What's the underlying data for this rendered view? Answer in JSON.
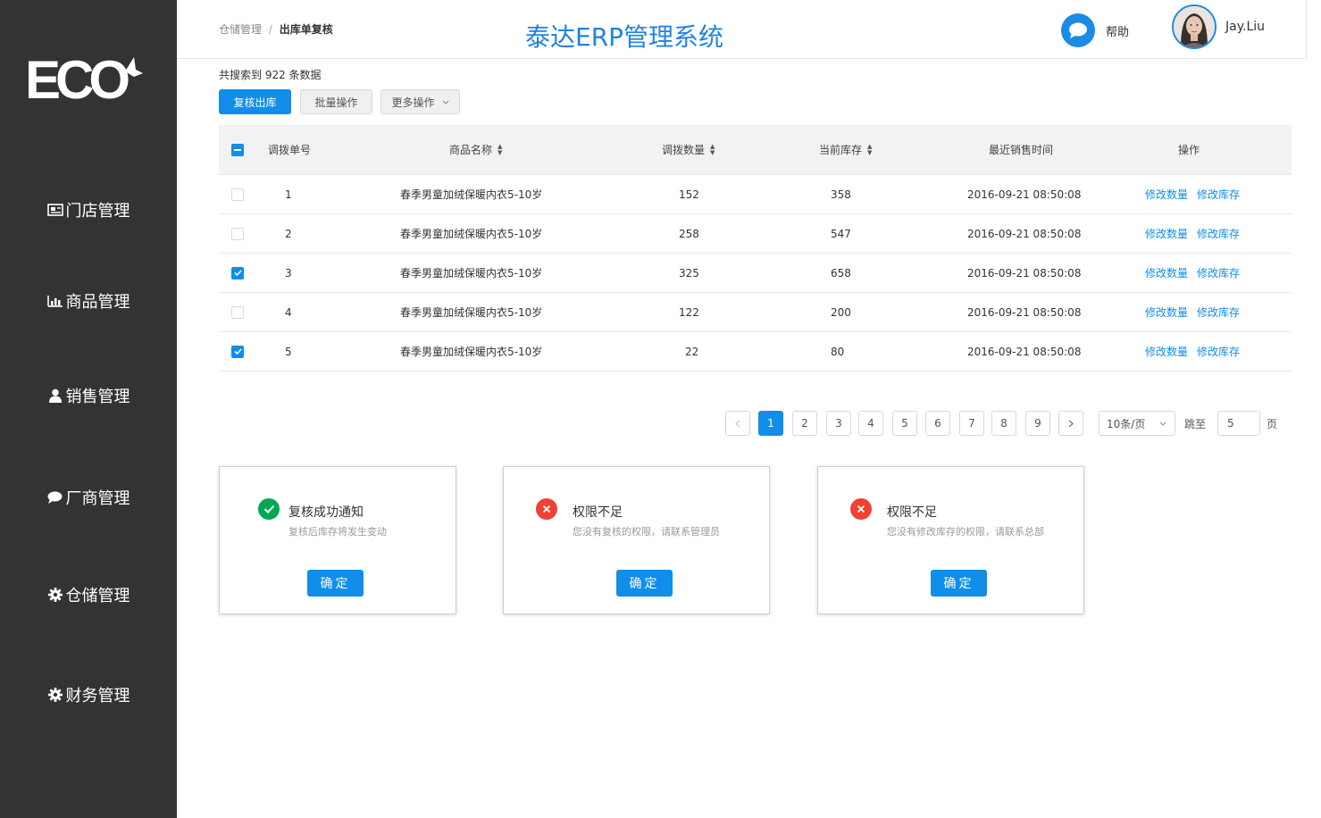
{
  "sidebar": {
    "logo_text": "ECO",
    "items": [
      {
        "label": "门店管理",
        "icon": "newspaper-icon"
      },
      {
        "label": "商品管理",
        "icon": "bar-chart-icon"
      },
      {
        "label": "销售管理",
        "icon": "user-icon"
      },
      {
        "label": "厂商管理",
        "icon": "comment-icon"
      },
      {
        "label": "仓储管理",
        "icon": "gear-icon"
      },
      {
        "label": "财务管理",
        "icon": "gear-icon"
      }
    ]
  },
  "header": {
    "breadcrumb_parent": "仓储管理",
    "breadcrumb_sep": "/",
    "breadcrumb_current": "出库单复核",
    "title": "泰达ERP管理系统",
    "help_label": "帮助",
    "user_name": "Jay.Liu"
  },
  "toolbar": {
    "count_text": "共搜索到 922 条数据",
    "review_label": "复核出库",
    "batch_label": "批量操作",
    "more_label": "更多操作"
  },
  "table": {
    "headers": {
      "id": "调拨单号",
      "name": "商品名称",
      "qty": "调拨数量",
      "stock": "当前库存",
      "time": "最近销售时间",
      "action": "操作"
    },
    "action_edit_qty": "修改数量",
    "action_edit_stock": "修改库存",
    "rows": [
      {
        "id": "1",
        "name": "春季男童加绒保暖内衣5-10岁",
        "qty": "152",
        "stock": "358",
        "time": "2016-09-21  08:50:08",
        "checked": false
      },
      {
        "id": "2",
        "name": "春季男童加绒保暖内衣5-10岁",
        "qty": "258",
        "stock": "547",
        "time": "2016-09-21  08:50:08",
        "checked": false
      },
      {
        "id": "3",
        "name": "春季男童加绒保暖内衣5-10岁",
        "qty": "325",
        "stock": "658",
        "time": "2016-09-21  08:50:08",
        "checked": true
      },
      {
        "id": "4",
        "name": "春季男童加绒保暖内衣5-10岁",
        "qty": "122",
        "stock": "200",
        "time": "2016-09-21  08:50:08",
        "checked": false
      },
      {
        "id": "5",
        "name": "春季男童加绒保暖内衣5-10岁",
        "qty": "22",
        "stock": "80",
        "time": "2016-09-21  08:50:08",
        "checked": true
      }
    ]
  },
  "pagination": {
    "pages": [
      "1",
      "2",
      "3",
      "4",
      "5",
      "6",
      "7",
      "8",
      "9"
    ],
    "current": "1",
    "page_size": "10条/页",
    "jump_label": "跳至",
    "jump_value": "5",
    "page_unit": "页"
  },
  "dialogs": [
    {
      "type": "success",
      "title": "复核成功通知",
      "message": "复核后库存将发生变动",
      "button": "确定"
    },
    {
      "type": "error",
      "title": "权限不足",
      "message": "您没有复核的权限，请联系管理员",
      "button": "确定"
    },
    {
      "type": "error",
      "title": "权限不足",
      "message": "您没有修改库存的权限，请联系总部",
      "button": "确定"
    }
  ],
  "colors": {
    "primary": "#108ee9",
    "sidebar": "#333333",
    "success": "#00a854",
    "error": "#f04134"
  }
}
